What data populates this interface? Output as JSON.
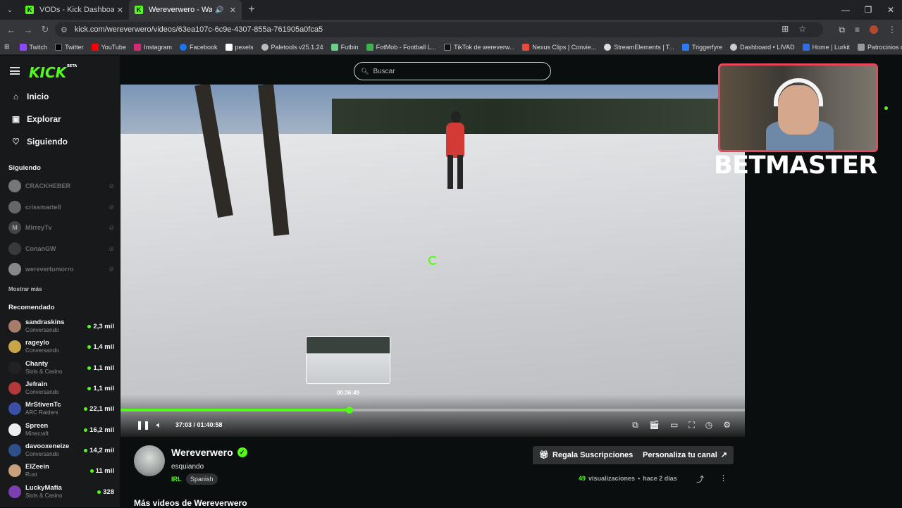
{
  "browser": {
    "tabs": [
      {
        "title": "VODs - Kick Dashboard",
        "active": false
      },
      {
        "title": "Wereverwero - Watch the V",
        "active": true
      }
    ],
    "url": "kick.com/wereverwero/videos/63ea107c-6c9e-4307-855a-761905a0fca5",
    "bookmarks": [
      "Twitch",
      "Twitter",
      "YouTube",
      "Instagram",
      "Facebook",
      "pexels",
      "Paletools v25.1.24",
      "Futbin",
      "FotMob - Football L...",
      "TikTok de wereverw...",
      "Nexus Clips | Convie...",
      "StreamElements | T...",
      "Triggerfyre",
      "Dashboard • LIVAD",
      "Home | Lurkit",
      "Patrocinios disponib..."
    ]
  },
  "kick": {
    "logo": "KICK",
    "logo_badge": "BETA",
    "search_placeholder": "Buscar",
    "nav": [
      {
        "label": "Inicio",
        "icon": "home-icon"
      },
      {
        "label": "Explorar",
        "icon": "compass-icon"
      },
      {
        "label": "Siguiendo",
        "icon": "heart-icon"
      }
    ],
    "following_title": "Siguiendo",
    "following": [
      "CRACKHEBER",
      "crissmartell",
      "MirreyTv",
      "ConanGW",
      "werevertumorro"
    ],
    "show_more": "Mostrar más",
    "recommended_title": "Recomendado",
    "recommended": [
      {
        "name": "sandraskins",
        "category": "Conversando",
        "viewers": "2,3 mil"
      },
      {
        "name": "rageylo",
        "category": "Conversando",
        "viewers": "1,4 mil"
      },
      {
        "name": "Chanty",
        "category": "Slots & Casino",
        "viewers": "1,1 mil"
      },
      {
        "name": "Jefrain",
        "category": "Conversando",
        "viewers": "1,1 mil"
      },
      {
        "name": "MrStivenTc",
        "category": "ARC Raiders",
        "viewers": "22,1 mil"
      },
      {
        "name": "Spreen",
        "category": "Minecraft",
        "viewers": "16,2 mil"
      },
      {
        "name": "davooxeneize",
        "category": "Conversando",
        "viewers": "14,2 mil"
      },
      {
        "name": "ElZeein",
        "category": "Rust",
        "viewers": "11 mil"
      },
      {
        "name": "LuckyMafia",
        "category": "Slots & Casino",
        "viewers": "328"
      }
    ]
  },
  "player": {
    "current_time": "37:03",
    "duration": "01:40:58",
    "time_display": "37:03 / 01:40:58",
    "progress_fraction": 0.367,
    "preview_time": "00:36:49",
    "accent": "#53fc18"
  },
  "overlay": {
    "sponsor": "BETMASTER"
  },
  "channel": {
    "name": "Wereverwero",
    "video_title": "esquiando",
    "category": "IRL",
    "language": "Spanish",
    "gift_button": "Regala Suscripciones",
    "customize_button": "Personaliza tu canal",
    "views_count": "49",
    "views_label": "visualizaciones",
    "age": "hace 2 días",
    "more_videos": "Más videos de Wereverwero"
  }
}
